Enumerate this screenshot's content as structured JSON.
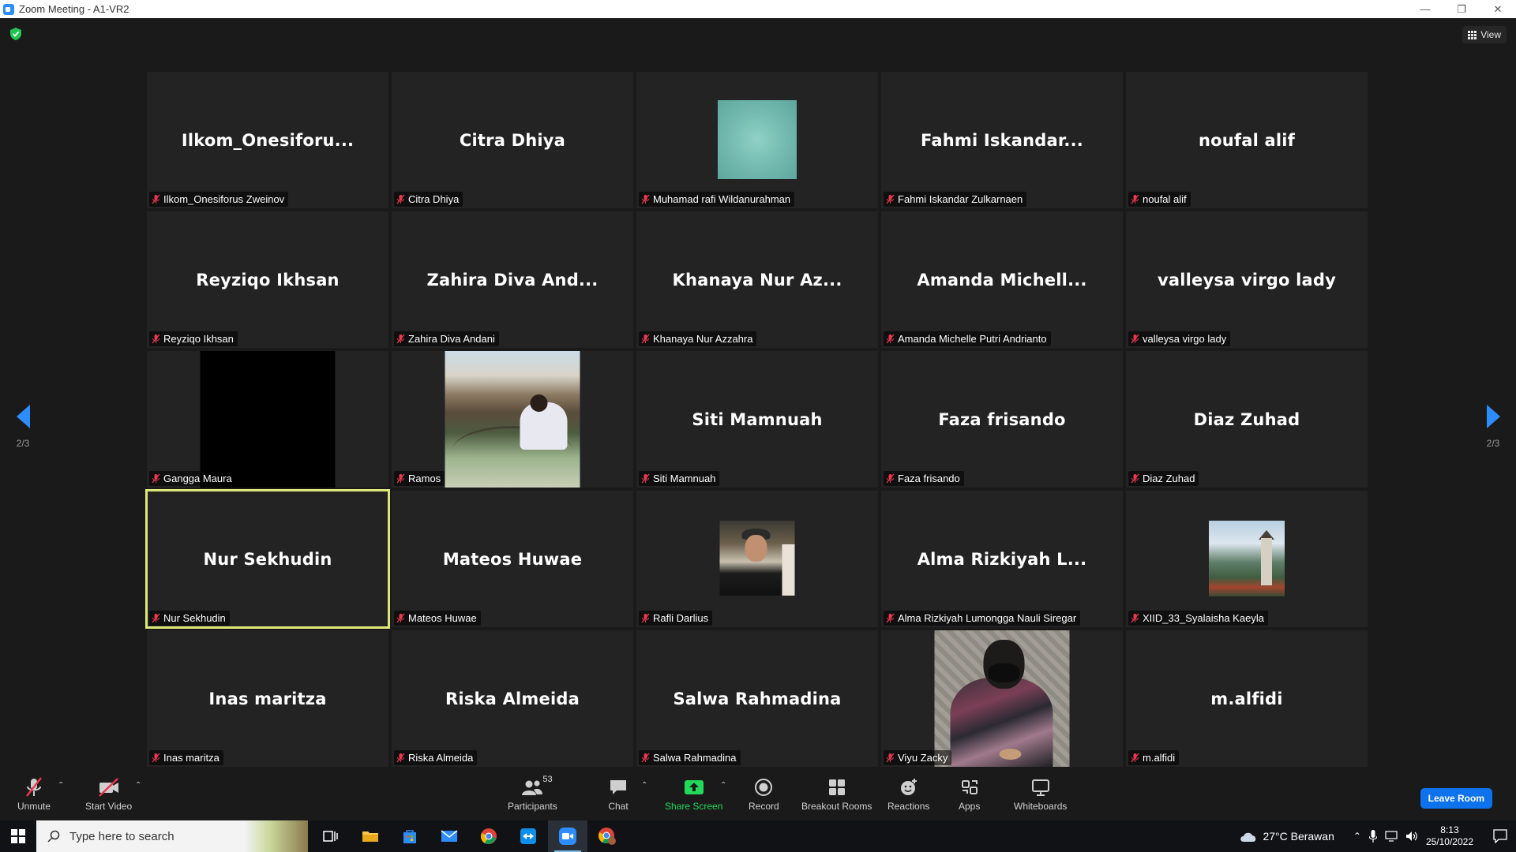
{
  "window": {
    "title": "Zoom Meeting - A1-VR2",
    "minimize": "—",
    "restore": "❐",
    "close": "✕"
  },
  "view_label": "View",
  "page_indicator": "2/3",
  "participants": [
    {
      "center": "Ilkom_Onesiforu...",
      "label": "Ilkom_Onesiforus Zweinov",
      "media": null
    },
    {
      "center": "Citra Dhiya",
      "label": "Citra Dhiya",
      "media": null
    },
    {
      "center": "",
      "label": "Muhamad rafi Wildanurahman",
      "media": "teal"
    },
    {
      "center": "Fahmi  Iskandar...",
      "label": "Fahmi Iskandar Zulkarnaen",
      "media": null
    },
    {
      "center": "noufal alif",
      "label": "noufal alif",
      "media": null
    },
    {
      "center": "Reyziqo Ikhsan",
      "label": "Reyziqo Ikhsan",
      "media": null
    },
    {
      "center": "Zahira Diva And...",
      "label": "Zahira Diva Andani",
      "media": null
    },
    {
      "center": "Khanaya Nur Az...",
      "label": "Khanaya Nur Azzahra",
      "media": null
    },
    {
      "center": "Amanda  Michell...",
      "label": "Amanda Michelle Putri Andrianto",
      "media": null
    },
    {
      "center": "valleysa virgo lady",
      "label": "valleysa virgo lady",
      "media": null
    },
    {
      "center": "",
      "label": "Gangga Maura",
      "media": "black"
    },
    {
      "center": "",
      "label": "Ramos",
      "media": "beach"
    },
    {
      "center": "Siti Mamnuah",
      "label": "Siti Mamnuah",
      "media": null
    },
    {
      "center": "Faza frisando",
      "label": "Faza frisando",
      "media": null
    },
    {
      "center": "Diaz Zuhad",
      "label": "Diaz Zuhad",
      "media": null
    },
    {
      "center": "Nur Sekhudin",
      "label": "Nur Sekhudin",
      "media": null,
      "active": true
    },
    {
      "center": "Mateos Huwae",
      "label": "Mateos Huwae",
      "media": null
    },
    {
      "center": "",
      "label": "Rafli Darlius",
      "media": "man"
    },
    {
      "center": "Alma  Rizkiyah  L...",
      "label": "Alma Rizkiyah Lumongga Nauli Siregar",
      "media": null
    },
    {
      "center": "",
      "label": "XIID_33_Syalaisha Kaeyla",
      "media": "castle"
    },
    {
      "center": "Inas maritza",
      "label": "Inas maritza",
      "media": null
    },
    {
      "center": "Riska Almeida",
      "label": "Riska Almeida",
      "media": null
    },
    {
      "center": "Salwa Rahmadina",
      "label": "Salwa Rahmadina",
      "media": null
    },
    {
      "center": "",
      "label": "Viyu Zacky",
      "media": "viyu"
    },
    {
      "center": "m.alfidi",
      "label": "m.alfidi",
      "media": null
    }
  ],
  "toolbar": {
    "unmute": "Unmute",
    "start_video": "Start Video",
    "participants": "Participants",
    "participants_count": "53",
    "chat": "Chat",
    "share_screen": "Share Screen",
    "record": "Record",
    "breakout_rooms": "Breakout Rooms",
    "reactions": "Reactions",
    "apps": "Apps",
    "whiteboards": "Whiteboards",
    "leave_room": "Leave Room"
  },
  "taskbar": {
    "search_placeholder": "Type here to search",
    "weather": "27°C  Berawan",
    "time": "8:13",
    "date": "25/10/2022"
  },
  "colors": {
    "accent": "#2d8cff",
    "active_speaker": "#dfe87a",
    "share_green": "#23d959",
    "mute_red": "#e8384f",
    "leave_blue": "#0e72ed"
  }
}
